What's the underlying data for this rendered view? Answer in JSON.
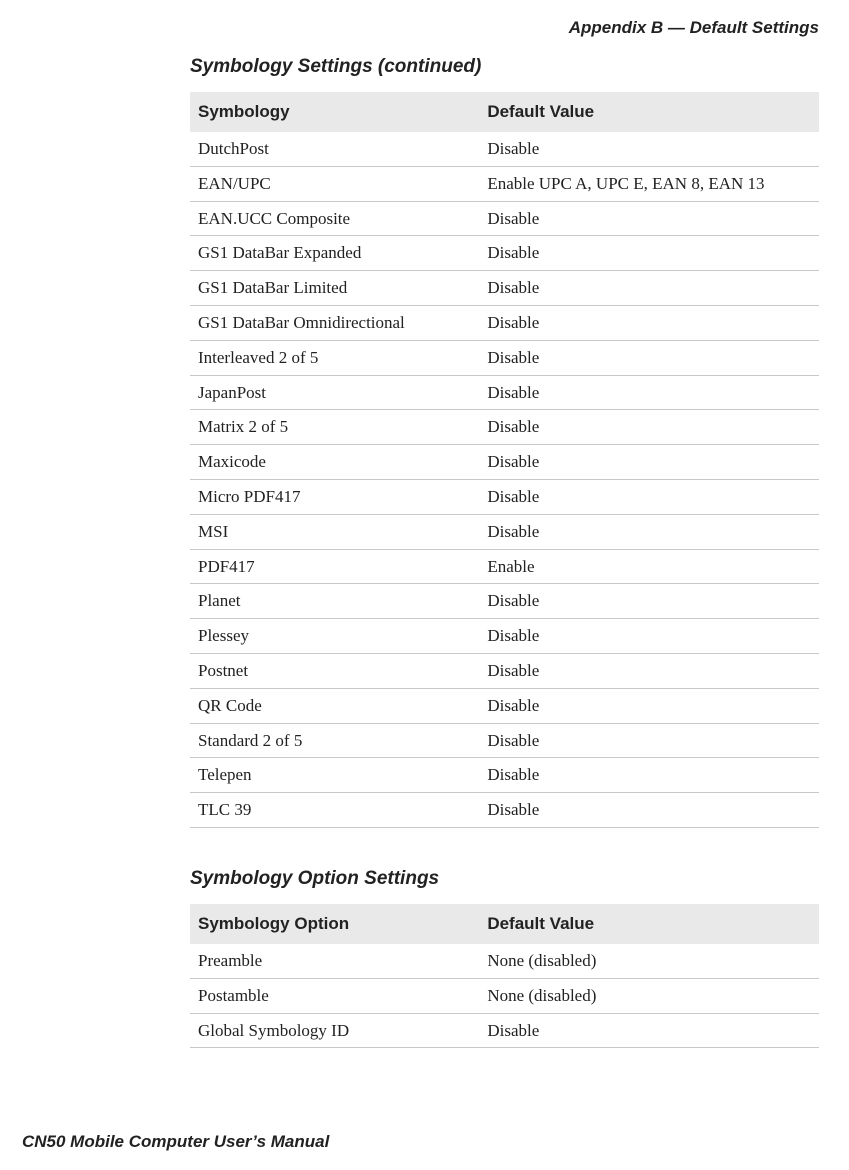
{
  "header": {
    "appendix": "Appendix B — Default Settings"
  },
  "section1": {
    "title": "Symbology Settings (continued)",
    "col1": "Symbology",
    "col2": "Default Value",
    "rows": [
      {
        "name": "DutchPost",
        "value": "Disable"
      },
      {
        "name": "EAN/UPC",
        "value": "Enable UPC A, UPC E, EAN 8, EAN 13"
      },
      {
        "name": "EAN.UCC Composite",
        "value": "Disable"
      },
      {
        "name": "GS1 DataBar Expanded",
        "value": "Disable"
      },
      {
        "name": "GS1 DataBar Limited",
        "value": "Disable"
      },
      {
        "name": "GS1 DataBar Omnidirectional",
        "value": "Disable"
      },
      {
        "name": "Interleaved 2 of 5",
        "value": "Disable"
      },
      {
        "name": "JapanPost",
        "value": "Disable"
      },
      {
        "name": "Matrix 2 of 5",
        "value": "Disable"
      },
      {
        "name": "Maxicode",
        "value": "Disable"
      },
      {
        "name": "Micro PDF417",
        "value": "Disable"
      },
      {
        "name": "MSI",
        "value": "Disable"
      },
      {
        "name": "PDF417",
        "value": "Enable"
      },
      {
        "name": "Planet",
        "value": "Disable"
      },
      {
        "name": "Plessey",
        "value": "Disable"
      },
      {
        "name": "Postnet",
        "value": "Disable"
      },
      {
        "name": "QR Code",
        "value": "Disable"
      },
      {
        "name": "Standard 2 of 5",
        "value": "Disable"
      },
      {
        "name": "Telepen",
        "value": "Disable"
      },
      {
        "name": "TLC 39",
        "value": "Disable"
      }
    ]
  },
  "section2": {
    "title": "Symbology Option Settings",
    "col1": "Symbology Option",
    "col2": "Default Value",
    "rows": [
      {
        "name": "Preamble",
        "value": "None (disabled)"
      },
      {
        "name": "Postamble",
        "value": "None (disabled)"
      },
      {
        "name": "Global Symbology ID",
        "value": "Disable"
      }
    ]
  },
  "footer": {
    "manual": "CN50 Mobile Computer User’s Manual"
  }
}
